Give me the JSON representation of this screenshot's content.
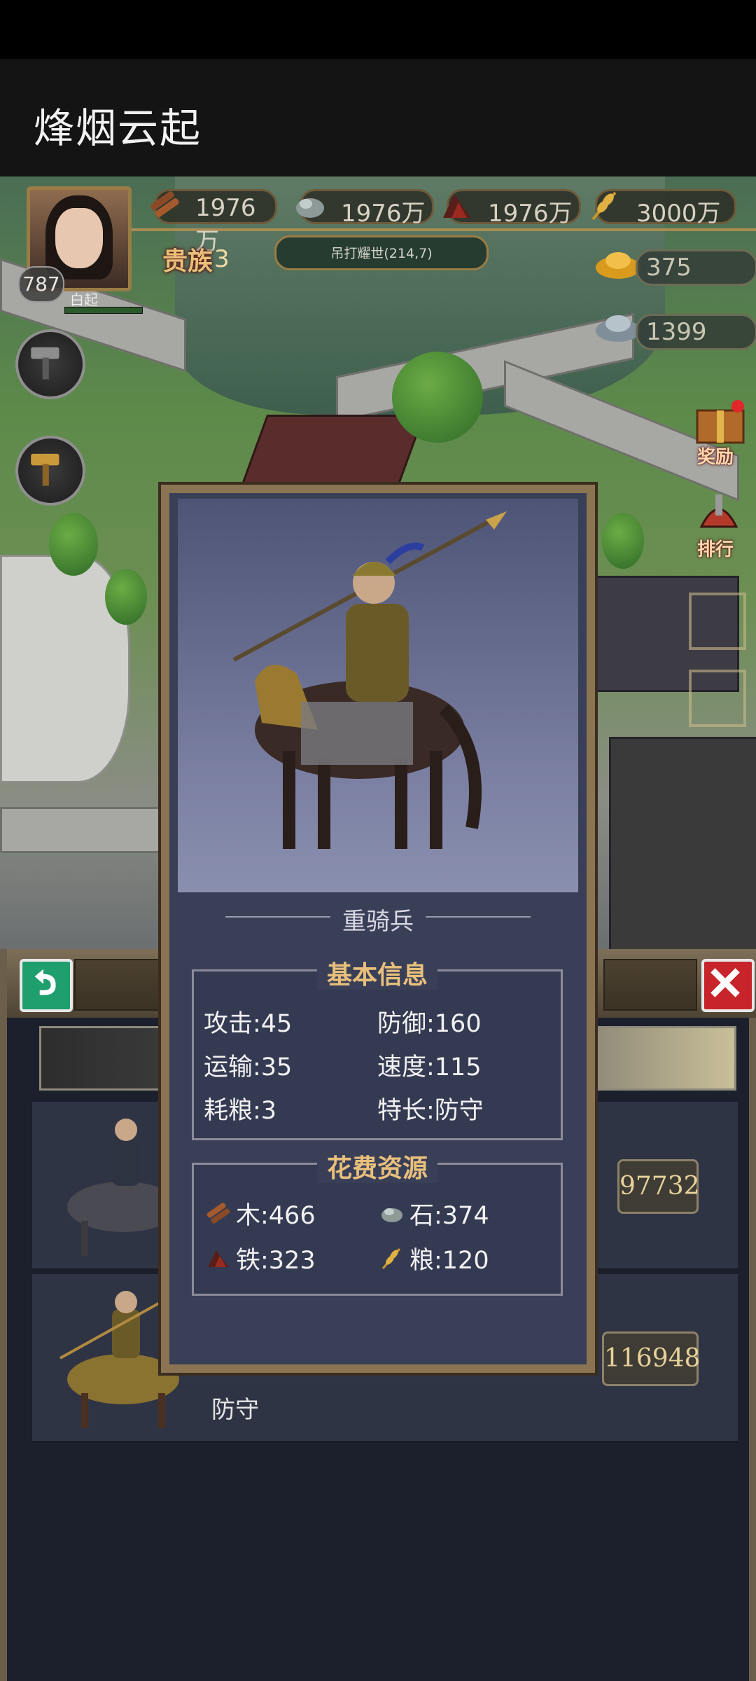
{
  "app_title": "烽烟云起",
  "resources": [
    {
      "icon": "wood-icon",
      "value": "1976万"
    },
    {
      "icon": "stone-icon",
      "value": "1976万"
    },
    {
      "icon": "iron-icon",
      "value": "1976万"
    },
    {
      "icon": "grain-icon",
      "value": "3000万"
    }
  ],
  "player": {
    "level": "787",
    "name": "白起",
    "vip_label": "贵族",
    "vip_level": "3",
    "location": "吊打耀世(214,7)"
  },
  "currencies": {
    "gold": "375",
    "silver": "1399"
  },
  "side_buttons": {
    "reward": "奖励",
    "ranking": "排行"
  },
  "panel": {
    "rows": [
      {
        "value": "97732",
        "text": ""
      },
      {
        "value": "116948",
        "text": "防守"
      }
    ]
  },
  "modal": {
    "unit_name": "重骑兵",
    "basic_title": "基本信息",
    "stats": {
      "attack": "攻击:45",
      "defense": "防御:160",
      "transport": "运输:35",
      "speed": "速度:115",
      "food": "耗粮:3",
      "specialty": "特长:防守"
    },
    "cost_title": "花费资源",
    "costs": {
      "wood": "木:466",
      "stone": "石:374",
      "iron": "铁:323",
      "grain": "粮:120"
    }
  },
  "colors": {
    "gold_trim": "#8b7452",
    "title_gold": "#e8c07c",
    "modal_bg": "#3a3f58",
    "close_red": "#c7252b",
    "back_green": "#1f9e6e"
  }
}
